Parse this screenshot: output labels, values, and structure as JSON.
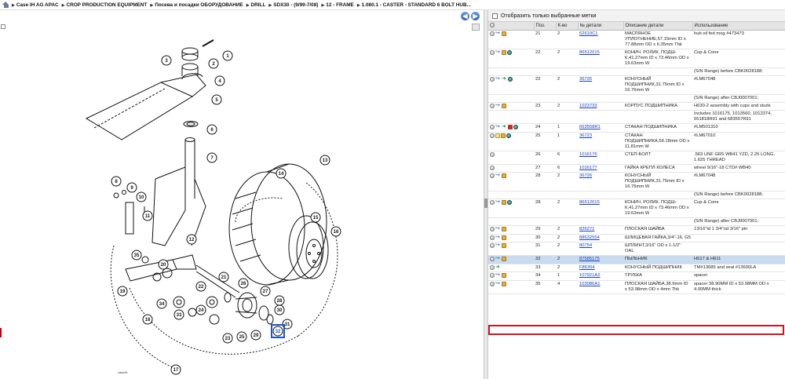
{
  "breadcrumb": [
    {
      "label": "Case IH AG APAC"
    },
    {
      "label": "CROP PRODUCTION EQUIPMENT"
    },
    {
      "label": "Посева и посадки ОБОРУДОВАНИЕ"
    },
    {
      "label": "DRILL"
    },
    {
      "label": "SDX30 - (9/99-7/08)"
    },
    {
      "label": "12 - FRAME"
    },
    {
      "label": "1.080.1 - CASTER - STANDARD 6 BOLT HUB..."
    }
  ],
  "nav": {
    "back": "◀",
    "forward": "▶"
  },
  "diagram": {
    "callouts": [
      "1",
      "2",
      "3",
      "4",
      "5",
      "6",
      "7",
      "8",
      "9",
      "10",
      "11",
      "12",
      "13",
      "14",
      "15",
      "16",
      "17",
      "18",
      "19",
      "20",
      "21",
      "22",
      "23",
      "24",
      "25",
      "26",
      "27",
      "28",
      "29",
      "30",
      "31",
      "32",
      "33",
      "34",
      "35"
    ],
    "highlighted": "32",
    "signature": "caseIH"
  },
  "filter": {
    "label": "Отобразить только выбранные метки"
  },
  "table": {
    "columns": [
      "Поз.",
      "К-во",
      "№ детали",
      "Описание детали",
      "Использование"
    ],
    "rows": [
      {
        "icons": [
          "grey",
          "blue",
          "box"
        ],
        "pos": "21",
        "qty": "2",
        "part": "62610C1",
        "desc": "МАСЛЯНОЕ УПЛОТНЕНИЕ,57.15mm ID x 77.88mm OD x 6.35mm Thk",
        "usage": "hub oil fed mog #473473"
      },
      {
        "icons": [
          "grey",
          "blue",
          "box",
          "globe"
        ],
        "pos": "22",
        "qty": "2",
        "part": "86512015",
        "desc": "КОНИЧ. РОЛИК. ПОДШ-К,41.27mm ID x 73.46mm OD x 19.63mm W",
        "usage": "Cup & Cone"
      },
      {
        "icons": [],
        "pos": "",
        "qty": "",
        "part": "",
        "desc": "",
        "usage": "(S/N Range) before CBK0028188;"
      },
      {
        "icons": [
          "grey",
          "blue",
          "green",
          "globe"
        ],
        "pos": "22",
        "qty": "2",
        "part": "36726",
        "desc": "КОНУСНЫЙ ПОДШИПНИК,31.75mm ID x 16.76mm W",
        "usage": "#LM67048"
      },
      {
        "icons": [],
        "pos": "",
        "qty": "",
        "part": "",
        "desc": "",
        "usage": "(S/N Range) after CBJ0007001;"
      },
      {
        "icons": [
          "grey",
          "blue",
          "box"
        ],
        "pos": "23",
        "qty": "2",
        "part": "1023733",
        "desc": "КОРПУС ПОДШИПНИКА",
        "usage": "H630-2 assembly with cups and studs"
      },
      {
        "icons": [],
        "pos": "",
        "qty": "",
        "part": "",
        "desc": "",
        "usage": "Includes 1016175, 1013560, 1012374, 651818R91 and 683557R91"
      },
      {
        "icons": [
          "grey",
          "blue",
          "green",
          "red",
          "globe"
        ],
        "pos": "24",
        "qty": "1",
        "part": "663558R1",
        "desc": "СТАКАН ПОДШИПНИКА",
        "usage": "#LM501310"
      },
      {
        "icons": [
          "grey",
          "note",
          "box",
          "globe"
        ],
        "pos": "25",
        "qty": "1",
        "part": "36723",
        "desc": "СТАКАН ПОДШИПНИКА,59.18mm OD x 11.81mm W",
        "usage": "#LM67010"
      },
      {
        "icons": [
          "grey"
        ],
        "pos": "26",
        "qty": "6",
        "part": "1016176",
        "desc": "СТЕП-БОЛТ",
        "usage": ".563 UNF GR5 WB41 YZD, 2.25 LONG, 1.625 THREAD"
      },
      {
        "icons": [
          "grey"
        ],
        "pos": "27",
        "qty": "6",
        "part": "1016177",
        "desc": "ГАЙКА КРЕПЛ КОЛЕСА",
        "usage": "wheel 9/16\"-18 CTD# WB40"
      },
      {
        "icons": [
          "grey",
          "blue",
          "box"
        ],
        "pos": "28",
        "qty": "2",
        "part": "36726",
        "desc": "КОНУСНЫЙ ПОДШИПНИК,31.75mm ID x 16.76mm W",
        "usage": "#LM67048"
      },
      {
        "icons": [],
        "pos": "",
        "qty": "",
        "part": "",
        "desc": "",
        "usage": "(S/N Range) before CBK0028188;"
      },
      {
        "icons": [
          "grey",
          "blue",
          "box",
          "globe"
        ],
        "pos": "28",
        "qty": "2",
        "part": "86512015",
        "desc": "КОНИЧ. РОЛИК. ПОДШ-К,41.27mm ID x 73.46mm OD x 19.63mm W",
        "usage": "Cup & Cone"
      },
      {
        "icons": [],
        "pos": "",
        "qty": "",
        "part": "",
        "desc": "",
        "usage": "(S/N Range) after CBJ0007001;"
      },
      {
        "icons": [
          "grey",
          "blue",
          "box"
        ],
        "pos": "29",
        "qty": "2",
        "part": "826271",
        "desc": "ПЛОСКАЯ ШАЙБА",
        "usage": "13/16\"id 1 3/4\"od 3/16\" pin"
      },
      {
        "icons": [
          "grey",
          "blue",
          "box"
        ],
        "pos": "30",
        "qty": "2",
        "part": "88632554",
        "desc": "ШЛИЦЕВАЯ ГАЙКА,3/4\"-16, G5",
        "usage": ""
      },
      {
        "icons": [
          "grey",
          "blue",
          "box"
        ],
        "pos": "31",
        "qty": "2",
        "part": "80754",
        "desc": "ШПЛИНТ,3/16\" OD x 1-1/2\" OAL",
        "usage": ""
      },
      {
        "icons": [
          "grey",
          "blue",
          "box"
        ],
        "pos": "32",
        "qty": "2",
        "part": "87585175",
        "desc": "ПЫЛЬНИК",
        "usage": "H517 & H611",
        "selected": true
      },
      {
        "icons": [
          "grey",
          "green"
        ],
        "pos": "33",
        "qty": "2",
        "part": "F86364",
        "desc": "КОНУСНЫЙ ПОДШИПНИК",
        "usage": "TM#13685 and seal #13600LA"
      },
      {
        "icons": [
          "grey",
          "blue",
          "box"
        ],
        "pos": "34",
        "qty": "1",
        "part": "107921A2",
        "desc": "ТРУБКА",
        "usage": "spacer"
      },
      {
        "icons": [
          "grey",
          "blue",
          "box"
        ],
        "pos": "35",
        "qty": "4",
        "part": "103086A1",
        "desc": "ПЛОСКАЯ ШАЙБА,38.9mm ID x 53.98mm OD x 4mm Thk",
        "usage": "spacer 38.90MM ID x 53.98MM OD x 4.00MM thick"
      }
    ]
  },
  "colors": {
    "selection": "#c9dcef",
    "highlight_border": "#d2141e",
    "link": "#1a3fb5"
  }
}
